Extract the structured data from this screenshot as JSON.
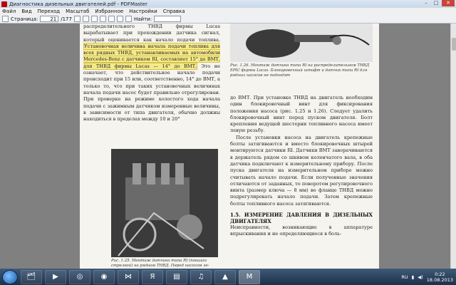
{
  "window": {
    "title": "Диагностика дизельных двигателей.pdf - PDFMaster",
    "buttons": [
      "–",
      "□",
      "✕"
    ]
  },
  "menu": [
    "Файл",
    "Вид",
    "Переход",
    "Масштаб",
    "Избранное",
    "Настройки",
    "Справка"
  ],
  "toolbar": {
    "page_label": "Страница:",
    "page_value": "21",
    "page_total": "/177",
    "find_label": "Найти:"
  },
  "document": {
    "left_col_top": "распределительного ТНВД фирмы Lucas вырабатывает при прохождении датчика сигнал, который оценивается как начало подачи топлива.",
    "left_col_highlight": "Установочная величина начала подачи топлива для всех рядных ТНВД, устанавливаемых на автомобили Mercedes-Benz с датчиком RI, составляет 15° до ВМТ, для ТНВД фирмы Lucas — 14° до ВМТ.",
    "left_col_rest": "Это не означает, что действительное начало подачи происходит при 15 или, соответственно, 14° до ВМТ, а только то, что при таких установочных величинах начала подачи насос будет правильно отрегулирован. При проверке на режиме холостого хода начала подачи с зажимным датчиком измеренные величины, в зависимости от типа двигателя, обычно должны находиться в пределах между 10 и 20°",
    "caption_126": "Рис. 1.26. Монтаж датчика типа RI на распределительном ТНВД EPIC фирмы Lucas. Блокировочный штифт и датчик типа RI для рядных насосов не подходят",
    "right_col_p1": "до ВМТ. При установке ТНВД на двигатель необходим один блокировочный винт для фиксирования положения насоса (рис. 1.25 и 1.26). Следует удалить блокировочный винт перед пуском двигателя. Болт крепления ведущей шестерни топливного насоса имеет левую резьбу.",
    "right_col_p2": "После установки насоса на двигатель крепежные болты затягиваются и вместо блокировочных штырей монтируются датчики RI. Датчики ВМТ заворачиваются в держатель рядом со шкивом коленчатого вала, в оба датчика подключают к измерительному прибору. После пуска двигателя на измерительном приборе можно считывать начало подачи. Если полученные значения отличаются от заданных, то поворотом регулировочного винта (размер ключа — 8 мм) во фланце ТНВД можно подрегулировать начало подачи. Затем крепежные болты топливного насоса затягиваются.",
    "heading": "1.5. ИЗМЕРЕНИЕ ДАВЛЕНИЯ В ДИЗЕЛЬНЫХ ДВИГАТЕЛЯХ",
    "right_col_p3": "Неисправности, возникающие в аппаратуре впрыскивания и не определяющиеся в боль-",
    "caption_125": "Рис. 1.25. Монтаж датчика типа RI (показан стрелкой) на рядном ТНВД. Перед насосом ле-"
  },
  "taskbar": {
    "apps": [
      "explorer-icon",
      "media-icon",
      "chrome-icon",
      "firefox-icon",
      "vs-icon",
      "yandex-icon",
      "folder-icon",
      "music-icon",
      "vlc-icon",
      "pdfmaster-icon"
    ],
    "lang": "RU",
    "time": "0:22",
    "date": "18.08.2013"
  },
  "colors": {
    "highlight": "#f5ea8a",
    "titlebar": "#c9d8ea",
    "taskbar": "#1d3048"
  }
}
